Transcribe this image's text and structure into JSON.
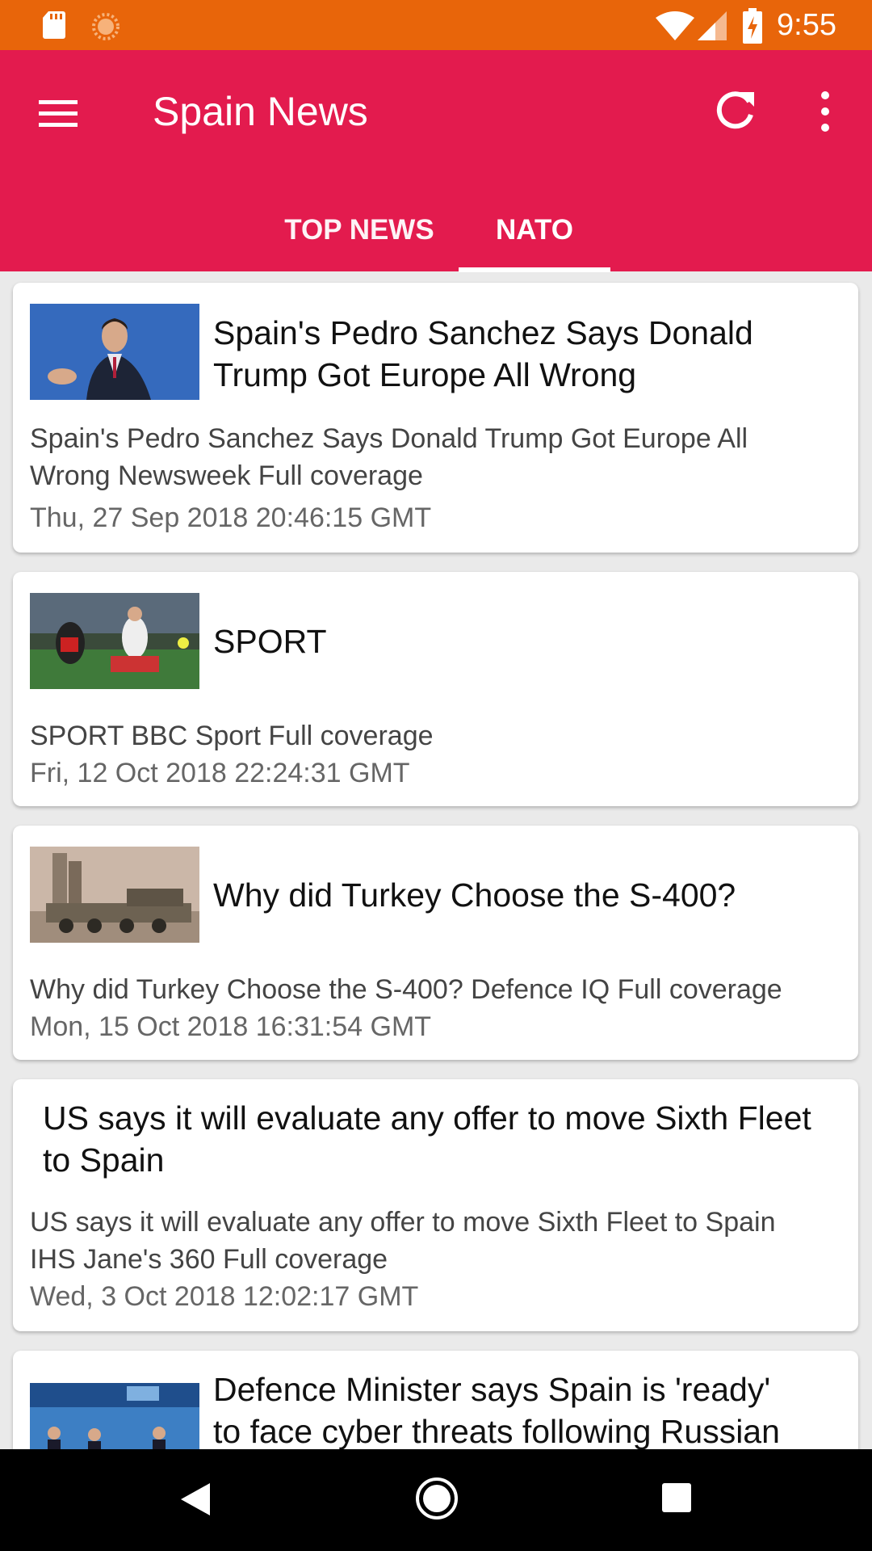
{
  "status_bar": {
    "time": "9:55",
    "icons": [
      "sd-card-icon",
      "sun-icon",
      "wifi-icon",
      "signal-icon",
      "battery-charging-icon"
    ]
  },
  "app_bar": {
    "title": "Spain News",
    "menu_icon": "hamburger-menu-icon",
    "refresh_icon": "refresh-icon",
    "more_icon": "more-vert-icon",
    "tabs": [
      {
        "label": "TOP NEWS",
        "selected": false
      },
      {
        "label": "NATO",
        "selected": true
      }
    ]
  },
  "colors": {
    "status_bar": "#e8650a",
    "app_bar": "#e31b4e",
    "background": "#eaeaea"
  },
  "articles": [
    {
      "title": "Spain's Pedro Sanchez Says Donald Trump Got Europe All Wrong",
      "desc_line1": "Spain's Pedro Sanchez Says Donald Trump Got Europe All",
      "desc_line2": "Wrong  Newsweek  Full coverage",
      "date": "Thu, 27 Sep 2018 20:46:15 GMT",
      "has_image": true
    },
    {
      "title": "SPORT",
      "desc_line1": "SPORT  BBC Sport  Full coverage",
      "date": "Fri, 12 Oct 2018 22:24:31 GMT",
      "has_image": true
    },
    {
      "title": "Why did Turkey Choose the S-400?",
      "desc_line1": "Why did Turkey Choose the S-400?  Defence IQ  Full coverage",
      "date": "Mon, 15 Oct 2018 16:31:54 GMT",
      "has_image": true
    },
    {
      "title": "US says it will evaluate any offer to move Sixth Fleet to Spain",
      "desc_line1": "US says it will evaluate any offer to move Sixth Fleet to Spain",
      "desc_line2": "IHS Jane's 360  Full coverage",
      "date": "Wed, 3 Oct 2018 12:02:17 GMT",
      "has_image": false
    },
    {
      "title_line1": "Defence Minister says Spain is 'ready'",
      "title_line2": "to face cyber threats following Russian",
      "has_image": true
    }
  ],
  "nav_bar": {
    "icons": [
      "back-icon",
      "home-icon",
      "recents-icon"
    ]
  }
}
